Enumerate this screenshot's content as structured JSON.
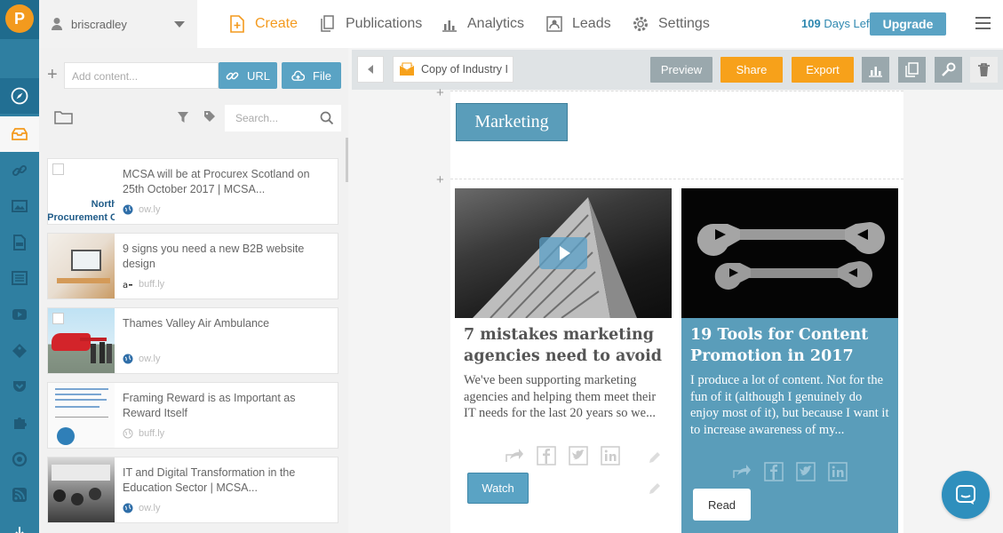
{
  "user": {
    "name": "briscradley"
  },
  "nav": [
    {
      "label": "Create",
      "icon": "create-icon"
    },
    {
      "label": "Publications",
      "icon": "publications-icon"
    },
    {
      "label": "Analytics",
      "icon": "analytics-icon"
    },
    {
      "label": "Leads",
      "icon": "leads-icon"
    },
    {
      "label": "Settings",
      "icon": "gear-icon"
    }
  ],
  "trial": {
    "days": "109",
    "suffix": "Days Left"
  },
  "upgrade_label": "Upgrade",
  "add_content": {
    "placeholder": "Add content...",
    "url_label": "URL",
    "file_label": "File"
  },
  "search": {
    "placeholder": "Search..."
  },
  "content_items": [
    {
      "title": "MCSA will be at Procurex Scotland on 25th October 2017 | MCSA...",
      "source": "ow.ly",
      "thumb_text": "North Procurement C"
    },
    {
      "title": "9 signs you need a new B2B website design",
      "source": "buff.ly"
    },
    {
      "title": "Thames Valley Air Ambulance",
      "source": "ow.ly"
    },
    {
      "title": "Framing Reward is as Important as Reward Itself",
      "source": "buff.ly"
    },
    {
      "title": "IT and Digital Transformation in the Education Sector | MCSA...",
      "source": "ow.ly"
    }
  ],
  "toolbar": {
    "doc_name": "Copy of Industry I",
    "preview": "Preview",
    "share": "Share",
    "export": "Export"
  },
  "editor": {
    "section_title": "Marketing",
    "cards": [
      {
        "title": "7 mistakes marketing agencies need to avoid",
        "body": "We've been supporting marketing agencies and helping them meet their IT needs for the last 20 years so we...",
        "button": "Watch"
      },
      {
        "title": "19 Tools for Content Promotion in 2017",
        "body": "I produce a lot of content. Not for the fun of it (although I genuinely do enjoy most of it), but because I want it to increase awareness of my...",
        "button": "Read"
      }
    ]
  },
  "colors": {
    "accent": "#f39a1e",
    "primary": "#5aa3c4",
    "rail": "#2f7fa1"
  }
}
